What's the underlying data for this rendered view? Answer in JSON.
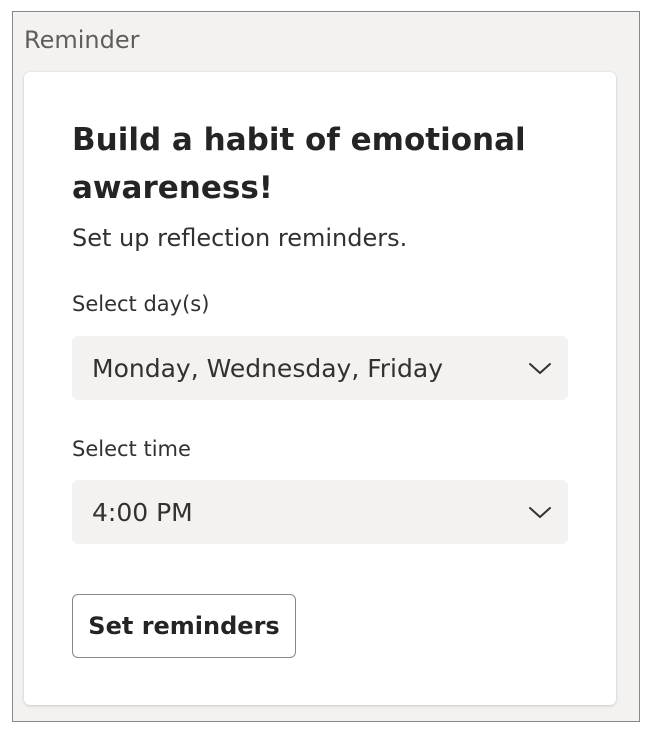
{
  "section": {
    "title": "Reminder"
  },
  "card": {
    "headline": "Build a habit of emotional awareness!",
    "subtext": "Set up reflection reminders."
  },
  "day_field": {
    "label": "Select day(s)",
    "selected_value": "Monday, Wednesday, Friday"
  },
  "time_field": {
    "label": "Select time",
    "selected_value": "4:00 PM"
  },
  "actions": {
    "set_reminders_label": "Set reminders"
  },
  "icons": {
    "dropdown_chevron": "chevron-down-icon"
  },
  "colors": {
    "panel_background": "#f3f2f1",
    "card_background": "#ffffff",
    "dropdown_background": "#f3f2f1",
    "text_primary": "#242424",
    "text_secondary": "#605e5c",
    "button_border": "#8a8886"
  }
}
